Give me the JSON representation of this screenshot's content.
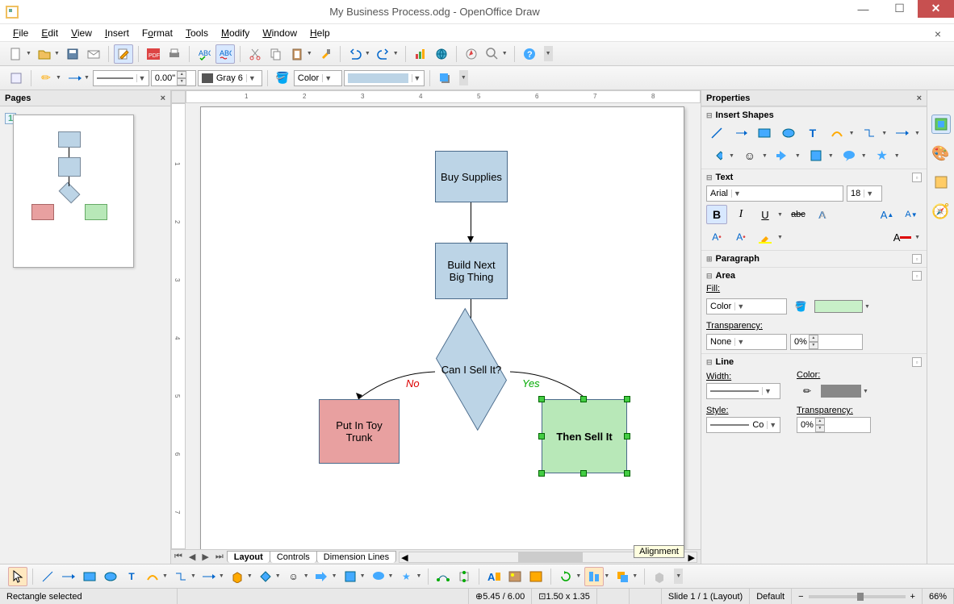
{
  "title": "My Business Process.odg - OpenOffice Draw",
  "menu": [
    "File",
    "Edit",
    "View",
    "Insert",
    "Format",
    "Tools",
    "Modify",
    "Window",
    "Help"
  ],
  "toolbar2": {
    "linewidth": "0.00\"",
    "colorname": "Gray 6",
    "fillmode": "Color"
  },
  "pagespanel": {
    "title": "Pages",
    "pagenum": "1"
  },
  "ruler_h": [
    "1",
    "2",
    "3",
    "4",
    "5",
    "6",
    "7",
    "8"
  ],
  "ruler_v": [
    "1",
    "2",
    "3",
    "4",
    "5",
    "6",
    "7"
  ],
  "shapes": {
    "buy": "Buy Supplies",
    "build": "Build Next Big Thing",
    "decide": "Can I Sell It?",
    "no": "No",
    "yes": "Yes",
    "trunk": "Put In Toy Trunk",
    "sell": "Then Sell It"
  },
  "canvas_tabs": [
    "Layout",
    "Controls",
    "Dimension Lines"
  ],
  "tooltip": "Alignment",
  "properties": {
    "title": "Properties",
    "insert_shapes": "Insert Shapes",
    "text": "Text",
    "font": "Arial",
    "size": "18",
    "paragraph": "Paragraph",
    "area": "Area",
    "fill_lbl": "Fill:",
    "fill_mode": "Color",
    "transparency_lbl": "Transparency:",
    "transparency_mode": "None",
    "transparency_val": "0%",
    "line": "Line",
    "width_lbl": "Width:",
    "color_lbl": "Color:",
    "style_lbl": "Style:",
    "style_val": "Co",
    "line_trans_lbl": "Transparency:",
    "line_trans_val": "0%"
  },
  "status": {
    "sel": "Rectangle selected",
    "pos": "5.45 / 6.00",
    "size": "1.50 x 1.35",
    "slide": "Slide 1 / 1 (Layout)",
    "style": "Default",
    "zoom": "66%"
  }
}
